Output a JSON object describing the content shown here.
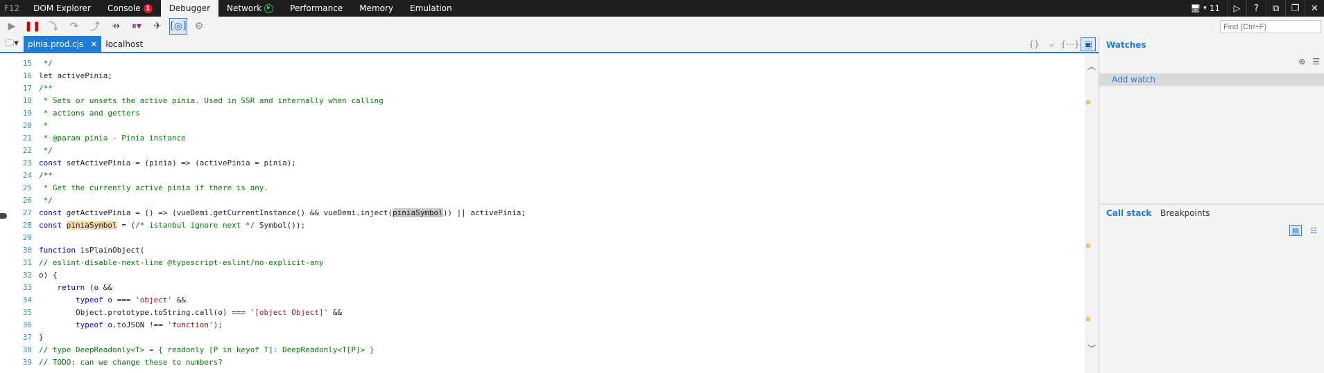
{
  "topbar": {
    "f12": "F12",
    "tabs": [
      {
        "label": "DOM Explorer"
      },
      {
        "label": "Console",
        "badge": "1"
      },
      {
        "label": "Debugger"
      },
      {
        "label": "Network"
      },
      {
        "label": "Performance"
      },
      {
        "label": "Memory"
      },
      {
        "label": "Emulation"
      }
    ],
    "emulation_count": "11"
  },
  "toolbar": {
    "find_placeholder": "Find (Ctrl+F)"
  },
  "file_tabs": {
    "active": "pinia.prod.cjs",
    "other": "localhost"
  },
  "code_lines": [
    {
      "n": "15",
      "t": " */"
    },
    {
      "n": "16",
      "t": "let activePinia;"
    },
    {
      "n": "17",
      "t": "/**"
    },
    {
      "n": "18",
      "t": " * Sets or unsets the active pinia. Used in SSR and internally when calling"
    },
    {
      "n": "19",
      "t": " * actions and getters"
    },
    {
      "n": "20",
      "t": " *"
    },
    {
      "n": "21",
      "t": " * @param pinia - Pinia instance"
    },
    {
      "n": "22",
      "t": " */"
    },
    {
      "n": "23",
      "t": "const setActivePinia = (pinia) => (activePinia = pinia);"
    },
    {
      "n": "24",
      "t": "/**"
    },
    {
      "n": "25",
      "t": " * Get the currently active pinia if there is any."
    },
    {
      "n": "26",
      "t": " */"
    },
    {
      "n": "27",
      "t": "const getActivePinia = () => (vueDemi.getCurrentInstance() && vueDemi.inject(piniaSymbol)) || activePinia;"
    },
    {
      "n": "28",
      "t": "const piniaSymbol = (/* istanbul ignore next */ Symbol());"
    },
    {
      "n": "29",
      "t": ""
    },
    {
      "n": "30",
      "t": "function isPlainObject("
    },
    {
      "n": "31",
      "t": "// eslint-disable-next-line @typescript-eslint/no-explicit-any"
    },
    {
      "n": "32",
      "t": "o) {"
    },
    {
      "n": "33",
      "t": "    return (o &&"
    },
    {
      "n": "34",
      "t": "        typeof o === 'object' &&"
    },
    {
      "n": "35",
      "t": "        Object.prototype.toString.call(o) === '[object Object]' &&"
    },
    {
      "n": "36",
      "t": "        typeof o.toJSON !== 'function');"
    },
    {
      "n": "37",
      "t": "}"
    },
    {
      "n": "38",
      "t": "// type DeepReadonly<T> = { readonly [P in keyof T]: DeepReadonly<T[P]> }"
    },
    {
      "n": "39",
      "t": "// TODO: can we change these to numbers?"
    }
  ],
  "watches": {
    "title": "Watches",
    "add_watch": "Add watch"
  },
  "bottom_tabs": {
    "call_stack": "Call stack",
    "breakpoints": "Breakpoints"
  },
  "colors": {
    "accent": "#1e7bd6",
    "keyword": "#0000ff",
    "comment": "#008000",
    "string": "#a31515",
    "line_number": "#2b91af"
  }
}
